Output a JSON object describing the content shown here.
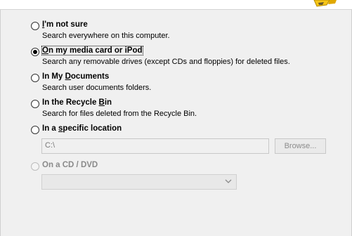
{
  "options": [
    {
      "title_pre": "",
      "title_u": "I",
      "title_post": "'m not sure",
      "desc": "Search everywhere on this computer."
    },
    {
      "title_pre": "",
      "title_u": "O",
      "title_post": "n my media card or iPod",
      "desc": "Search any removable drives (except CDs and floppies) for deleted files."
    },
    {
      "title_pre": "In My ",
      "title_u": "D",
      "title_post": "ocuments",
      "desc": "Search user documents folders."
    },
    {
      "title_pre": "In the Recycle ",
      "title_u": "B",
      "title_post": "in",
      "desc": "Search for files deleted from the Recycle Bin."
    },
    {
      "title_pre": "In a ",
      "title_u": "s",
      "title_post": "pecific location",
      "desc": ""
    },
    {
      "title_pre": "On a CD / DVD",
      "title_u": "",
      "title_post": "",
      "desc": ""
    }
  ],
  "selected_option": 1,
  "location": {
    "value": "C:\\",
    "browse_label": "Browse..."
  },
  "cd_dvd": {
    "selected": ""
  },
  "colors": {
    "panel": "#f0f0f0",
    "disabled_text": "#8a8a8a",
    "icon_yellow": "#f5c518"
  },
  "icons": {
    "wizard": "drive-wizard-icon",
    "dropdown": "chevron-down-icon"
  }
}
